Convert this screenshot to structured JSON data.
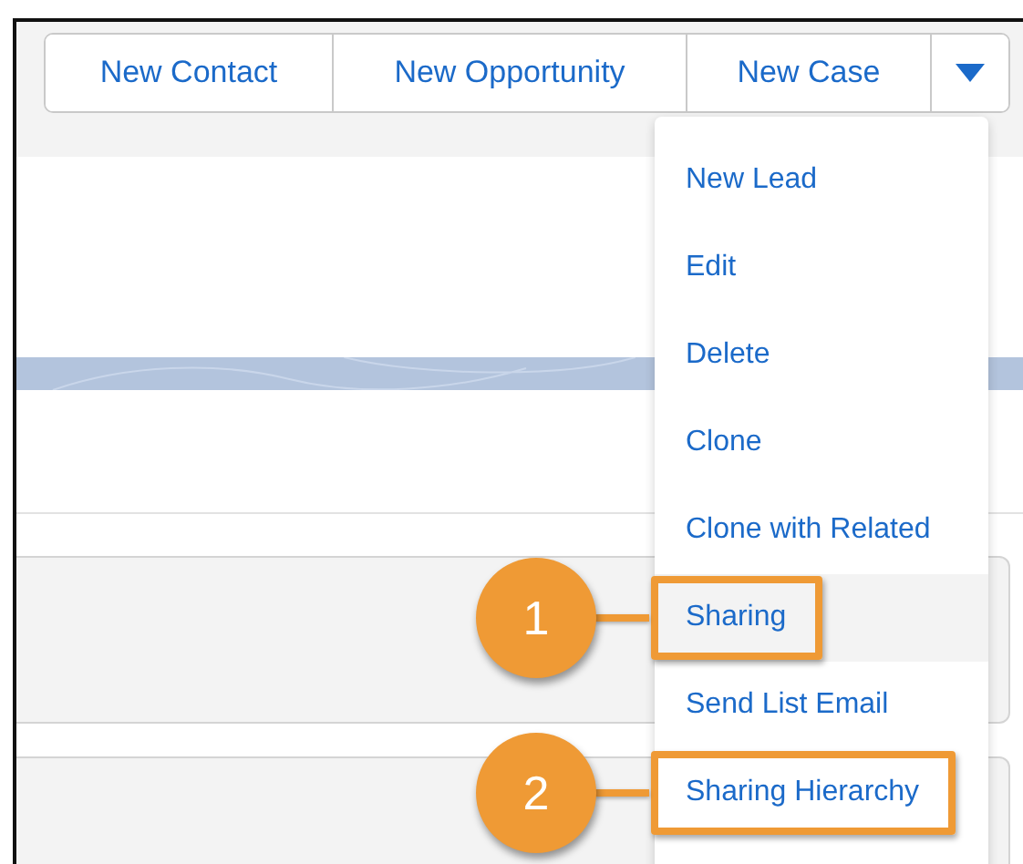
{
  "action_buttons": [
    {
      "label": "New Contact"
    },
    {
      "label": "New Opportunity"
    },
    {
      "label": "New Case"
    }
  ],
  "menu": {
    "items": [
      {
        "label": "New Lead",
        "selected": false
      },
      {
        "label": "Edit",
        "selected": false
      },
      {
        "label": "Delete",
        "selected": false
      },
      {
        "label": "Clone",
        "selected": false
      },
      {
        "label": "Clone with Related",
        "selected": false
      },
      {
        "label": "Sharing",
        "selected": true,
        "callout": "1"
      },
      {
        "label": "Send List Email",
        "selected": false
      },
      {
        "label": "Sharing Hierarchy",
        "selected": false,
        "callout": "2"
      }
    ]
  }
}
